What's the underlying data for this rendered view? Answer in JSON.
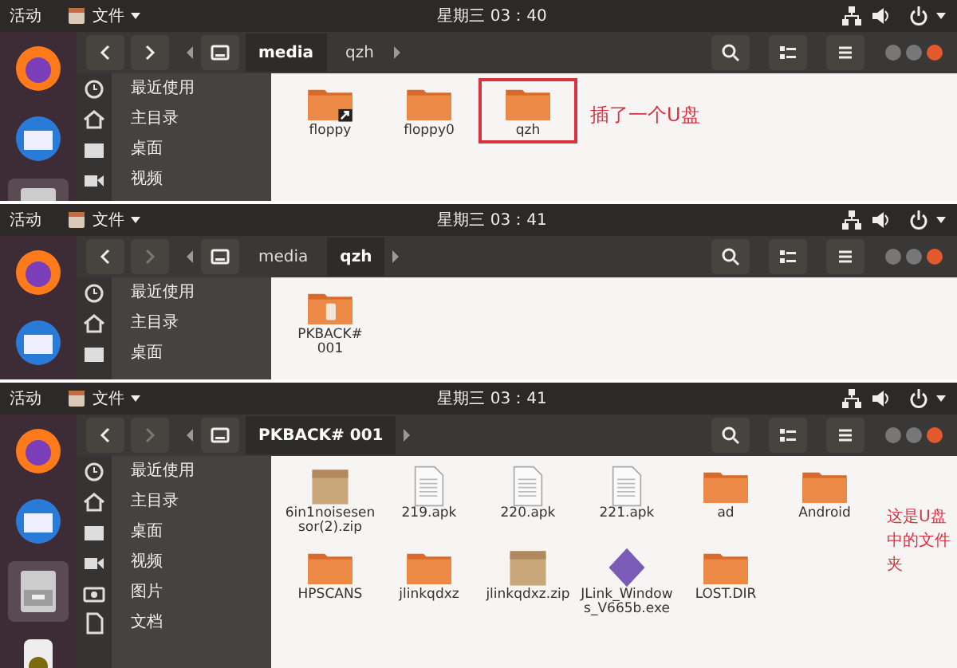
{
  "panels": [
    {
      "top_bar": {
        "activities": "活动",
        "app_menu": "文件",
        "clock": "星期三 03：40"
      },
      "forward_disabled": false,
      "path": [
        {
          "label": "media",
          "selected": true
        },
        {
          "label": "qzh",
          "selected": false
        }
      ],
      "sidebar": [
        "最近使用",
        "主目录",
        "桌面",
        "视频"
      ],
      "files": [
        {
          "name": "floppy",
          "kind": "folder-link",
          "highlighted": false
        },
        {
          "name": "floppy0",
          "kind": "folder",
          "highlighted": false
        },
        {
          "name": "qzh",
          "kind": "folder",
          "highlighted": true
        }
      ],
      "annotation": "插了一个U盘"
    },
    {
      "top_bar": {
        "activities": "活动",
        "app_menu": "文件",
        "clock": "星期三 03：41"
      },
      "forward_disabled": true,
      "path": [
        {
          "label": "media",
          "selected": false
        },
        {
          "label": "qzh",
          "selected": true
        }
      ],
      "sidebar": [
        "最近使用",
        "主目录",
        "桌面"
      ],
      "files": [
        {
          "name": "PKBACK# 001",
          "kind": "folder-usb",
          "highlighted": false
        }
      ]
    },
    {
      "top_bar": {
        "activities": "活动",
        "app_menu": "文件",
        "clock": "星期三 03：41"
      },
      "forward_disabled": true,
      "path": [
        {
          "label": "PKBACK# 001",
          "selected": true
        }
      ],
      "sidebar": [
        "最近使用",
        "主目录",
        "桌面",
        "视频",
        "图片",
        "文档"
      ],
      "files": [
        {
          "name": "6in1noisesensor(2).zip",
          "kind": "zip",
          "highlighted": false
        },
        {
          "name": "219.apk",
          "kind": "doc",
          "highlighted": false
        },
        {
          "name": "220.apk",
          "kind": "doc",
          "highlighted": false
        },
        {
          "name": "221.apk",
          "kind": "doc",
          "highlighted": false
        },
        {
          "name": "ad",
          "kind": "folder",
          "highlighted": false
        },
        {
          "name": "Android",
          "kind": "folder",
          "highlighted": false
        },
        {
          "name": "HPSCANS",
          "kind": "folder",
          "highlighted": false
        },
        {
          "name": "jlinkqdxz",
          "kind": "folder",
          "highlighted": false
        },
        {
          "name": "jlinkqdxz.zip",
          "kind": "zip",
          "highlighted": false
        },
        {
          "name": "JLink_Windows_V665b.exe",
          "kind": "exe",
          "highlighted": false
        },
        {
          "name": "LOST.DIR",
          "kind": "folder",
          "highlighted": false
        }
      ],
      "annotation": "这是U盘中的文件夹"
    }
  ]
}
